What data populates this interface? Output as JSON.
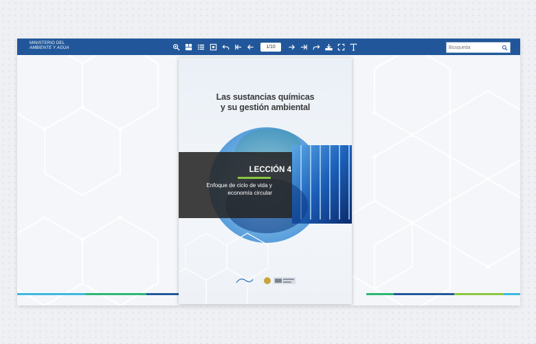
{
  "header": {
    "brand_line1": "MINISTERIO DEL",
    "brand_line2": "AMBIENTE Y AGUA"
  },
  "toolbar": {
    "tools": [
      "zoom-in-icon",
      "thumbnails-icon",
      "table-of-contents-icon",
      "fit-page-icon",
      "undo-icon",
      "first-page-icon",
      "previous-page-icon"
    ],
    "page_indicator": "1/10",
    "tools_right": [
      "next-page-icon",
      "last-page-icon",
      "share-icon",
      "download-icon",
      "fullscreen-icon",
      "text-icon"
    ]
  },
  "search": {
    "placeholder": "Búsqueda",
    "value": ""
  },
  "page": {
    "title_line1": "Las sustancias químicas",
    "title_line2": "y su gestión ambiental",
    "lesson": "LECCIÓN 4",
    "desc_line1": "Enfoque de ciclo de vida y",
    "desc_line2": "economía circular"
  },
  "colors": {
    "toolbar": "#21579a",
    "accent_green": "#8cc63f",
    "bar_colors": [
      "#3cb8e0",
      "#2bb673",
      "#21579a",
      "#8cc63f"
    ]
  }
}
